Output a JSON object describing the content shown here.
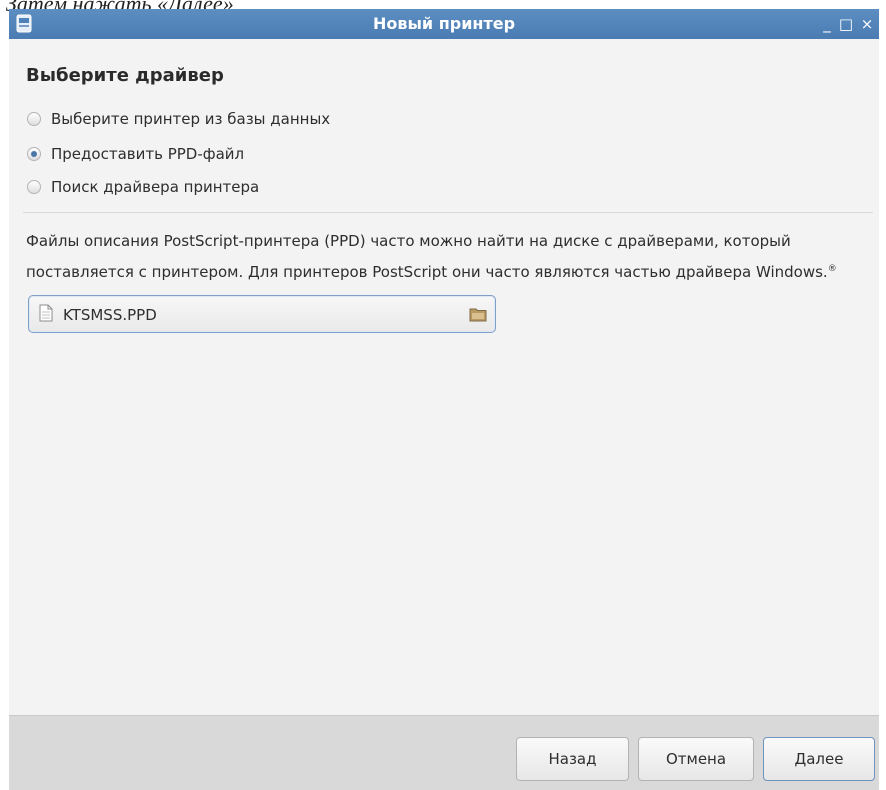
{
  "page_caption": "Затем нажать «Далее»",
  "window": {
    "title": "Новый принтер",
    "controls": {
      "minimize": "_",
      "maximize": "□",
      "close": "×"
    }
  },
  "heading": "Выберите драйвер",
  "radios": [
    {
      "label": "Выберите принтер из базы данных",
      "checked": false
    },
    {
      "label": "Предоставить PPD-файл",
      "checked": true
    },
    {
      "label": "Поиск драйвера принтера",
      "checked": false
    }
  ],
  "description": {
    "line1": "Файлы описания PostScript-принтера (PPD) часто можно найти на диске с драйверами, который",
    "line2": "поставляется с принтером. Для принтеров PostScript они часто являются частью драйвера Windows.",
    "mark": "®"
  },
  "file_chooser": {
    "value": "KTSMSS.PPD",
    "icons": {
      "file": "document-icon",
      "browse": "folder-icon"
    }
  },
  "buttons": {
    "back": "Назад",
    "cancel": "Отмена",
    "next": "Далее"
  },
  "colors": {
    "titlebar": "#4f82b9",
    "window_bg": "#f3f3f3",
    "footer_bg": "#d9d9d9",
    "accent": "#4a77a8"
  }
}
